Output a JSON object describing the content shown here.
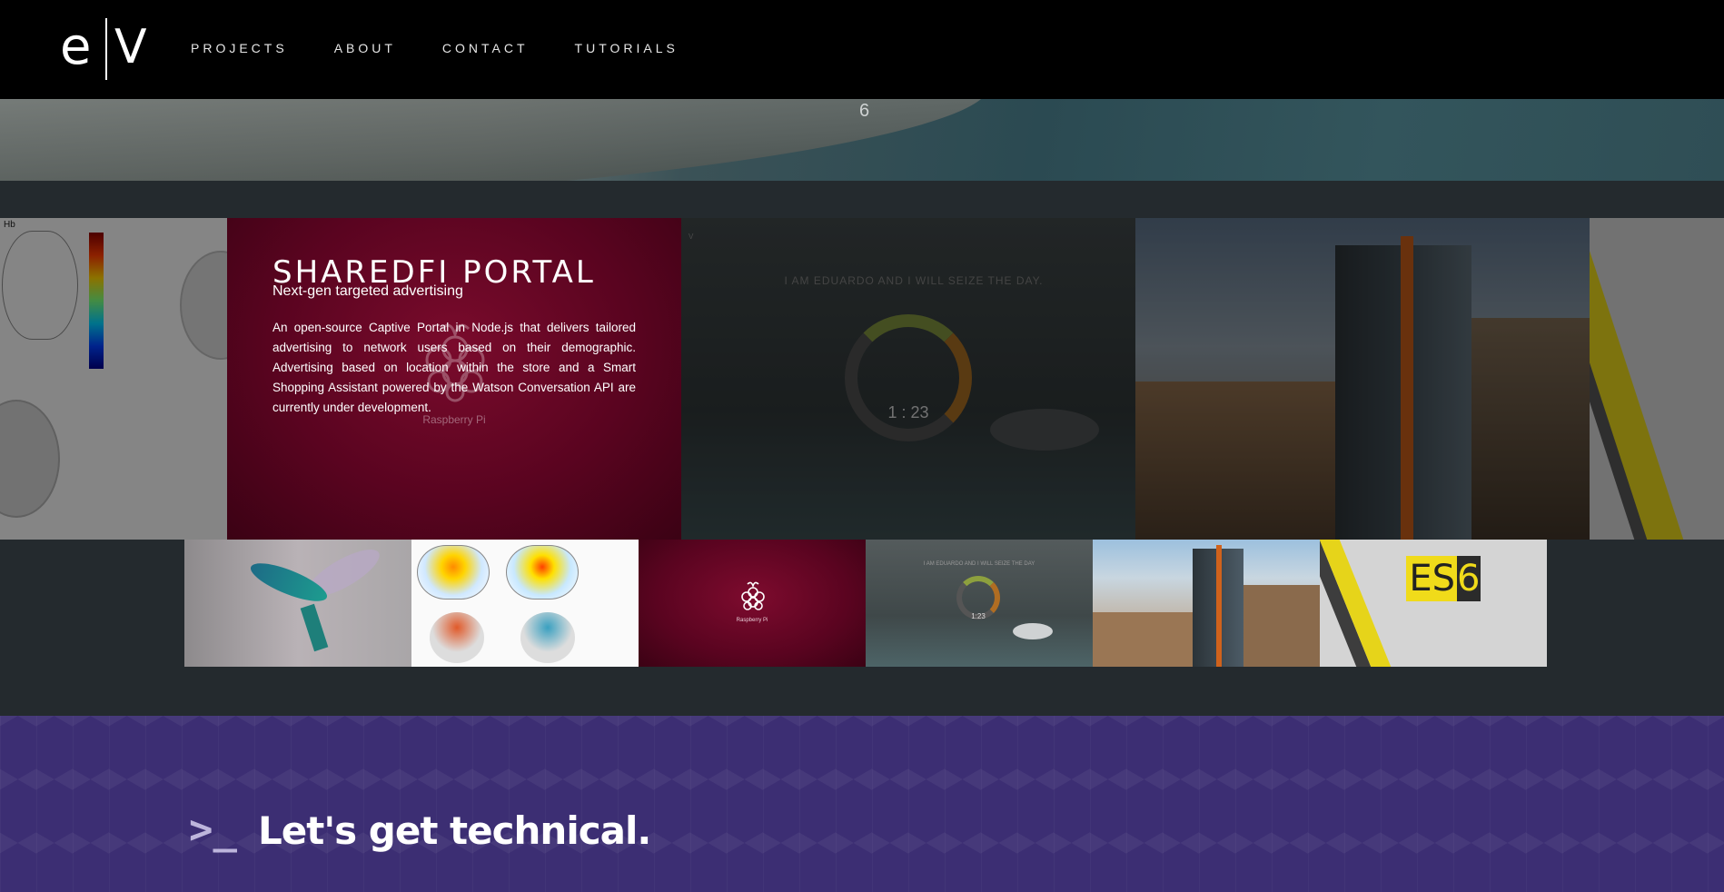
{
  "nav": {
    "logo_left": "e",
    "logo_right": "V",
    "items": [
      {
        "label": "PROJECTS"
      },
      {
        "label": "ABOUT"
      },
      {
        "label": "CONTACT"
      },
      {
        "label": "TUTORIALS"
      }
    ]
  },
  "hero": {
    "fragment": "6"
  },
  "carousel": {
    "brain_slide": {
      "label": "Hb"
    },
    "active_slide": {
      "title": "SHAREDFI PORTAL",
      "subtitle": "Next-gen targeted advertising",
      "description": "An open-source Captive Portal in Node.js that delivers tailored advertising to network users based on their demographic. Advertising based on location within the store and a Smart Shopping Assistant powered by the Watson Conversation API are currently under development.",
      "background_label": "Raspberry Pi"
    },
    "clock_slide": {
      "greeting": "I AM EDUARDO AND I WILL SEIZE THE DAY.",
      "time": "1 : 23"
    }
  },
  "thumbnails": {
    "rpi_label": "Raspberry Pi",
    "clock_header": "I AM EDUARDO AND I WILL SEIZE THE DAY",
    "clock_time": "1:23",
    "es6_left": "ES",
    "es6_right": "6"
  },
  "tech": {
    "prompt_symbol": ">_",
    "heading": "Let's get technical."
  },
  "colors": {
    "nav_bg": "#000000",
    "page_bg": "#242a2e",
    "active_slide": "#5a0420",
    "tech_bg": "#3c2e73"
  }
}
